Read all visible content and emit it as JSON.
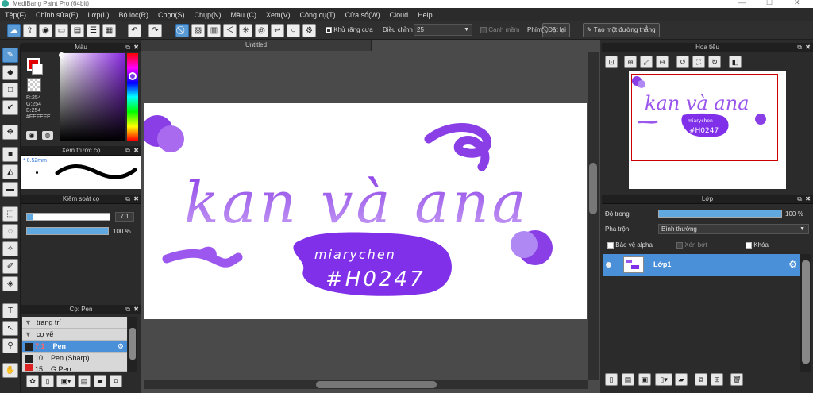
{
  "app": {
    "title": "MediBang Paint Pro (64bit)"
  },
  "menu": [
    "Tệp(F)",
    "Chỉnh sửa(E)",
    "Lớp(L)",
    "Bộ lọc(R)",
    "Chọn(S)",
    "Chụp(N)",
    "Màu (C)",
    "Xem(V)",
    "Công cụ(T)",
    "Cửa sổ(W)",
    "Cloud",
    "Help"
  ],
  "toolbar": {
    "antialias_label": "Khử răng cưa",
    "antialias_checked": true,
    "adjust_label": "Điều chỉnh",
    "brush_size_value": "25",
    "smooth_edge_label": "Cạnh mềm",
    "key_label": "Phím",
    "reset_label": "Đặt lại",
    "straight_line_label": "Tạo một đường thẳng"
  },
  "color_panel": {
    "title": "Màu",
    "r": "R:254",
    "g": "G:254",
    "b": "B:254",
    "hex": "#FEFEFE",
    "primary_color": "#e00000",
    "secondary_color": "#ffffff"
  },
  "brush_preview": {
    "title": "Xem trước cọ",
    "size": "0.52mm"
  },
  "brush_control": {
    "title": "Kiểm soát cọ",
    "size_value": "7.1",
    "opacity_value": "100 %",
    "size_fraction": 0.07,
    "opacity_fraction": 1.0
  },
  "brush_list": {
    "title": "Cọ: Pen",
    "items": [
      {
        "label": "trang trí",
        "kind": "group"
      },
      {
        "label": "cọ vẽ",
        "kind": "group"
      },
      {
        "size": "7.1",
        "label": "Pen",
        "selected": true
      },
      {
        "size": "10",
        "label": "Pen (Sharp)"
      },
      {
        "size": "15",
        "label": "G Pen"
      }
    ]
  },
  "canvas": {
    "tab_title": "Untitled",
    "text_main": "kan và ana",
    "text_badge_1": "miarychen",
    "text_badge_2": "#H0247",
    "accent": "#8a3ee6"
  },
  "navigator": {
    "title": "Hoa tiêu",
    "text_main": "kan và ana",
    "text_badge_1": "miarychen",
    "text_badge_2": "#H0247"
  },
  "layers": {
    "title": "Lớp",
    "opacity_label": "Độ trong",
    "opacity_value": "100 %",
    "opacity_fraction": 1.0,
    "blend_label": "Pha trộn",
    "blend_value": "Bình thường",
    "protect_alpha": "Bảo vệ alpha",
    "clipping": "Xén bớt",
    "lock": "Khóa",
    "items": [
      {
        "name": "Lớp1",
        "selected": true
      }
    ]
  }
}
